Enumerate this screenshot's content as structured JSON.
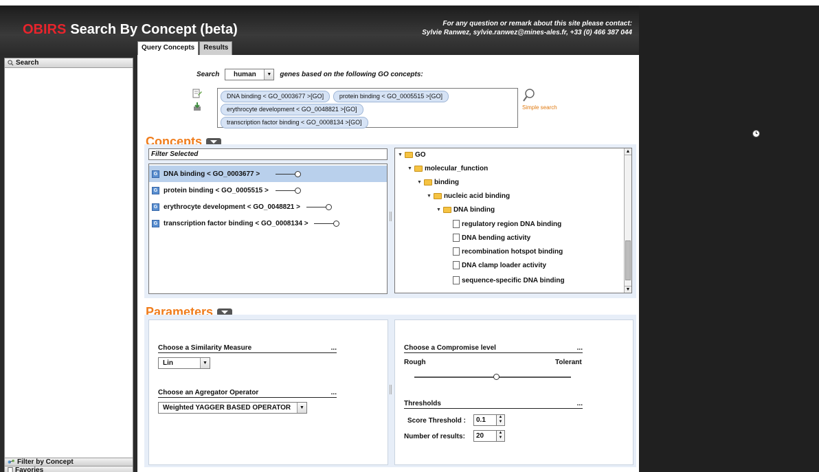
{
  "header": {
    "logo": "OBIRS",
    "title": "Search By Concept (beta)",
    "contact_line1": "For any question or remark about this site please contact:",
    "contact_line2": "Sylvie Ranwez, sylvie.ranwez@mines-ales.fr, +33 (0) 466 387 044"
  },
  "tabs": [
    {
      "label": "Query Concepts",
      "active": true
    },
    {
      "label": "Results",
      "active": false
    }
  ],
  "sidebar": {
    "search_label": "Search",
    "filter_label": "Filter by Concept",
    "favorites_label": "Favories"
  },
  "query": {
    "search_label": "Search",
    "species_value": "human",
    "after_label": "genes based on the following GO concepts:",
    "tags": [
      "DNA binding < GO_0003677 >[GO]",
      "protein binding < GO_0005515 >[GO]",
      "erythrocyte development < GO_0048821 >[GO]",
      "transcription factor binding < GO_0008134 >[GO]"
    ],
    "simple_search": "Simple search"
  },
  "concepts": {
    "title": "Concepts",
    "filter_label": "Filter Selected",
    "items": [
      {
        "label": "DNA binding < GO_0003677 >",
        "selected": true
      },
      {
        "label": "protein binding < GO_0005515 >",
        "selected": false
      },
      {
        "label": "erythrocyte development < GO_0048821 >",
        "selected": false
      },
      {
        "label": "transcription factor binding < GO_0008134 >",
        "selected": false
      }
    ]
  },
  "tree": {
    "nodes": [
      {
        "label": "GO",
        "type": "folder",
        "level": 0
      },
      {
        "label": "molecular_function",
        "type": "folder",
        "level": 1
      },
      {
        "label": "binding",
        "type": "folder",
        "level": 2
      },
      {
        "label": "nucleic acid binding",
        "type": "folder",
        "level": 3
      },
      {
        "label": "DNA binding",
        "type": "folder",
        "level": 4
      },
      {
        "label": "regulatory region DNA binding",
        "type": "leaf",
        "level": 5
      },
      {
        "label": "DNA bending activity",
        "type": "leaf",
        "level": 5
      },
      {
        "label": "recombination hotspot binding",
        "type": "leaf",
        "level": 5
      },
      {
        "label": "DNA clamp loader activity",
        "type": "leaf",
        "level": 5
      },
      {
        "label": "sequence-specific DNA binding",
        "type": "leaf",
        "level": 5
      }
    ]
  },
  "parameters": {
    "title": "Parameters",
    "similarity_title": "Choose a Similarity Measure",
    "similarity_value": "Lin",
    "aggregator_title": "Choose an Agregator Operator",
    "aggregator_value": "Weighted YAGGER BASED OPERATOR",
    "compromise_title": "Choose a Compromise level",
    "rough_label": "Rough",
    "tolerant_label": "Tolerant",
    "thresholds_title": "Thresholds",
    "score_threshold_label": "Score Threshold :",
    "score_threshold_value": "0.1",
    "num_results_label": "Number of results:",
    "num_results_value": "20",
    "ellipsis": "..."
  }
}
